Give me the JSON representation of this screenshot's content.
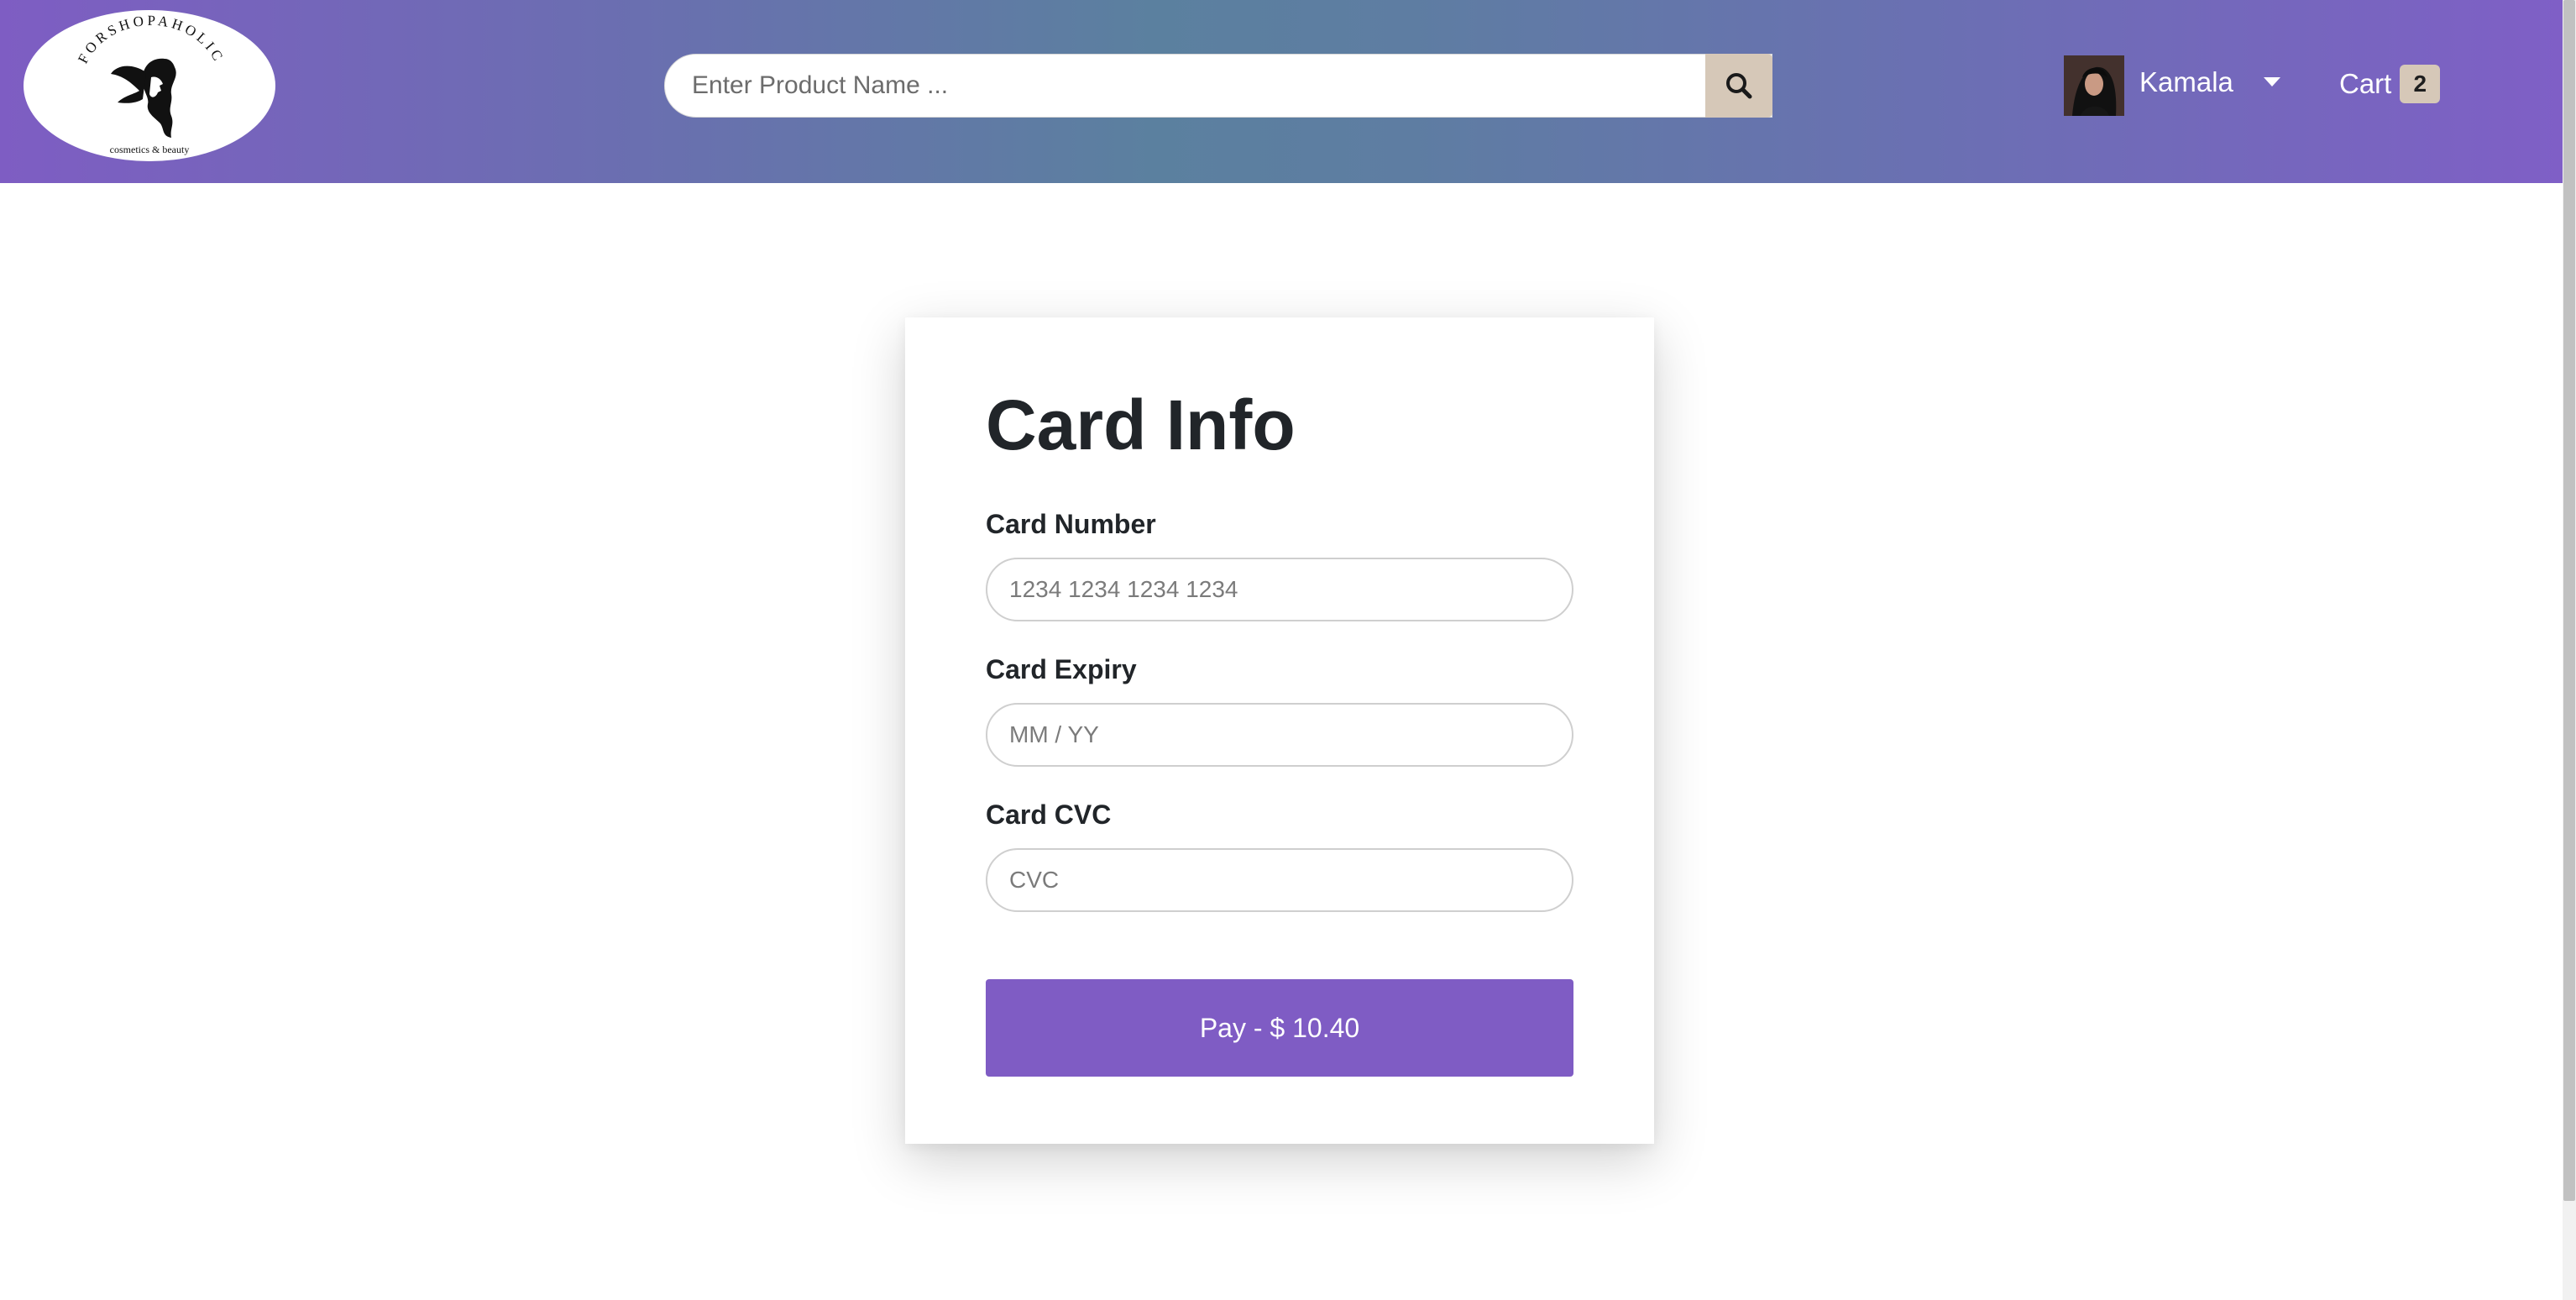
{
  "brand": {
    "name": "FORSHOPAHOLIC",
    "tagline": "cosmetics & beauty"
  },
  "header": {
    "search": {
      "placeholder": "Enter Product Name ..."
    },
    "user": {
      "name": "Kamala"
    },
    "cart": {
      "label": "Cart",
      "count": "2"
    }
  },
  "card_form": {
    "title": "Card Info",
    "fields": [
      {
        "label": "Card Number",
        "placeholder": "1234 1234 1234 1234"
      },
      {
        "label": "Card Expiry",
        "placeholder": "MM / YY"
      },
      {
        "label": "Card CVC",
        "placeholder": "CVC"
      }
    ],
    "pay_button": "Pay - $ 10.40"
  },
  "colors": {
    "header_gradient": [
      "#7e5dc3",
      "#5b809f",
      "#7f5fc6"
    ],
    "accent": "#7f5cc4",
    "badge": "#d6c8b8"
  },
  "icons": {
    "search": "search-icon",
    "caret": "caret-down-icon"
  }
}
